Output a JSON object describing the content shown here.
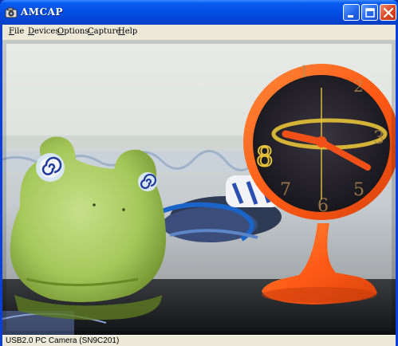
{
  "window": {
    "title": "AMCAP"
  },
  "menu": [
    {
      "underline": "F",
      "rest": "ile"
    },
    {
      "underline": "D",
      "rest": "evices"
    },
    {
      "underline": "O",
      "rest": "ptions"
    },
    {
      "underline": "C",
      "rest": "apture"
    },
    {
      "underline": "H",
      "rest": "elp"
    }
  ],
  "video": {
    "clock_numerals": [
      "1",
      "2",
      "3",
      "5",
      "6",
      "7",
      "8"
    ]
  },
  "status": {
    "text": "USB2.0 PC Camera (SN9C201)"
  },
  "colors": {
    "titlebar": "#0550e6",
    "menubar": "#ece9d8",
    "clock": "#ff5a14",
    "frog": "#a8cf5a"
  },
  "icons": [
    "app-camera-icon",
    "minimize-icon",
    "maximize-icon",
    "close-icon"
  ]
}
